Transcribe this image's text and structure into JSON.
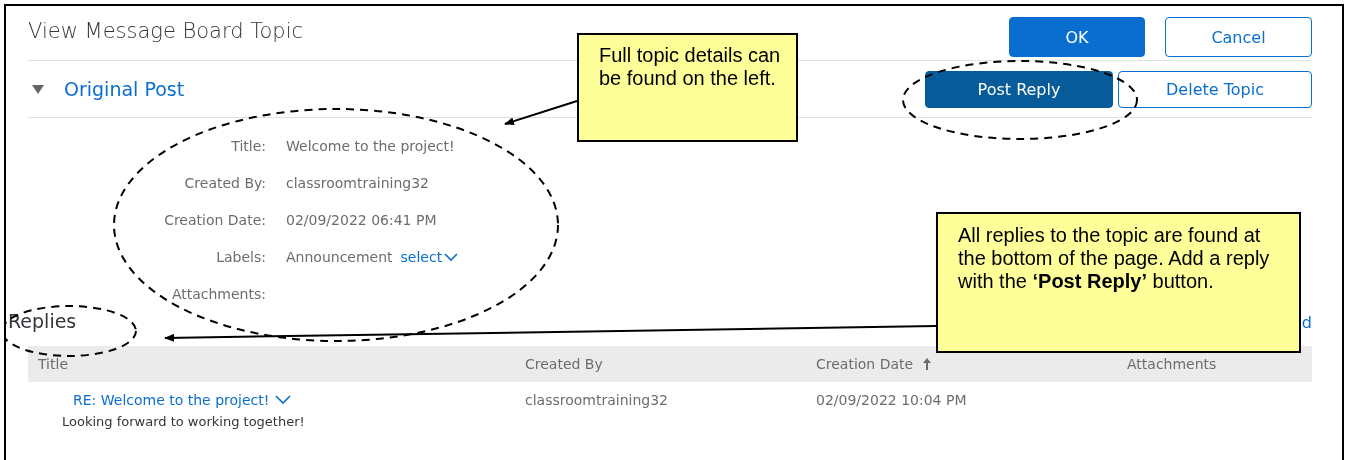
{
  "window": {
    "title": "View Message Board Topic"
  },
  "header_buttons": [
    {
      "label": "OK",
      "kind": "primary"
    },
    {
      "label": "Cancel",
      "kind": "secondary"
    }
  ],
  "section": {
    "title": "Original Post",
    "expanded": true
  },
  "section_buttons": [
    {
      "label": "Post Reply",
      "kind": "emphasized"
    },
    {
      "label": "Delete Topic",
      "kind": "secondary"
    }
  ],
  "fields": [
    {
      "label": "Title:",
      "value": "Welcome to the project!"
    },
    {
      "label": "Created By:",
      "value": "classroomtraining32"
    },
    {
      "label": "Creation Date:",
      "value": "02/09/2022 06:41 PM"
    },
    {
      "label": "Labels:",
      "value": "Announcement",
      "link": "select"
    },
    {
      "label": "Attachments:"
    }
  ],
  "replies": {
    "title": "Replies",
    "partial_link": "d",
    "columns": [
      {
        "label": "Title"
      },
      {
        "label": "Created By"
      },
      {
        "label": "Creation Date",
        "sorted": true
      },
      {
        "label": "Attachments"
      }
    ],
    "rows": [
      {
        "title": "RE: Welcome to the project!",
        "body": "Looking forward to working together!",
        "created_by": "classroomtraining32",
        "creation_date": "02/09/2022 10:04 PM"
      }
    ]
  },
  "callouts": [
    {
      "text": "Full topic details can be found on the left."
    },
    {
      "text": "All replies to the topic are found at the bottom of the page. Add a reply with the **‘Post Reply’** button."
    }
  ]
}
